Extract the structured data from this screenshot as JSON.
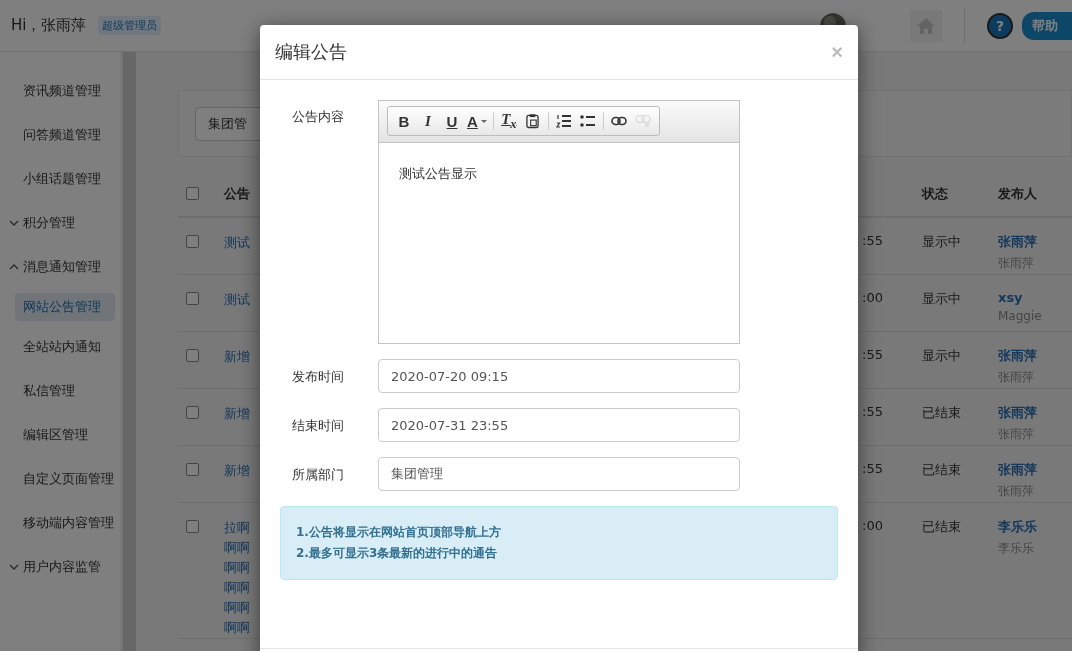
{
  "topbar": {
    "greeting": "Hi，张雨萍",
    "role_badge": "超级管理员",
    "help_icon": "?",
    "help_label": "帮助"
  },
  "sidebar": {
    "items": [
      {
        "label": "资讯频道管理",
        "kind": "link",
        "selected": false
      },
      {
        "label": "问答频道管理",
        "kind": "link",
        "selected": false
      },
      {
        "label": "小组话题管理",
        "kind": "link",
        "selected": false
      },
      {
        "label": "积分管理",
        "kind": "group",
        "expanded": false
      },
      {
        "label": "消息通知管理",
        "kind": "group",
        "expanded": true,
        "children": [
          {
            "label": "网站公告管理",
            "kind": "link",
            "selected": true
          },
          {
            "label": "全站站内通知",
            "kind": "link",
            "selected": false
          },
          {
            "label": "私信管理",
            "kind": "link",
            "selected": false
          },
          {
            "label": "编辑区管理",
            "kind": "link",
            "selected": false
          },
          {
            "label": "自定义页面管理",
            "kind": "link",
            "selected": false
          },
          {
            "label": "移动端内容管理",
            "kind": "link",
            "selected": false
          }
        ]
      },
      {
        "label": "用户内容监管",
        "kind": "group",
        "expanded": false
      }
    ]
  },
  "filter": {
    "department": "集团管"
  },
  "table": {
    "all_checked": false,
    "columns": [
      "公告",
      "状态",
      "发布人"
    ],
    "rows": [
      {
        "checked": false,
        "title": [
          "测试"
        ],
        "time": ":55",
        "status": "显示中",
        "publisher": "张雨萍",
        "publisher_sub": "张雨萍"
      },
      {
        "checked": false,
        "title": [
          "测试"
        ],
        "time": ":00",
        "status": "显示中",
        "publisher": "xsy",
        "publisher_sub": "Maggie"
      },
      {
        "checked": false,
        "title": [
          "新增"
        ],
        "time": ":55",
        "status": "显示中",
        "publisher": "张雨萍",
        "publisher_sub": "张雨萍"
      },
      {
        "checked": false,
        "title": [
          "新增"
        ],
        "time": ":55",
        "status": "已结束",
        "publisher": "张雨萍",
        "publisher_sub": "张雨萍"
      },
      {
        "checked": false,
        "title": [
          "新增"
        ],
        "time": ":55",
        "status": "已结束",
        "publisher": "张雨萍",
        "publisher_sub": "张雨萍"
      },
      {
        "checked": false,
        "title": [
          "拉啊",
          "啊啊",
          "啊啊",
          "啊啊",
          "啊啊",
          "啊啊"
        ],
        "time": ":00",
        "status": "已结束",
        "publisher": "李乐乐",
        "publisher_sub": "李乐乐"
      }
    ]
  },
  "modal": {
    "title": "编辑公告",
    "close": "×",
    "content_label": "公告内容",
    "toolbar": [
      {
        "kind": "text",
        "label": "B"
      },
      {
        "kind": "text",
        "label": "I"
      },
      {
        "kind": "text",
        "label": "U"
      },
      {
        "kind": "text",
        "label": "A"
      },
      {
        "kind": "sep"
      },
      {
        "kind": "text",
        "label": "T$_{x}$"
      },
      {
        "kind": "icon",
        "disabled": false
      },
      {
        "kind": "sep"
      },
      {
        "kind": "icon",
        "disabled": false
      },
      {
        "kind": "icon",
        "disabled": false
      },
      {
        "kind": "sep"
      },
      {
        "kind": "icon",
        "disabled": false
      },
      {
        "kind": "icon",
        "disabled": true
      }
    ],
    "content": "测试公告显示",
    "fields": [
      {
        "label": "发布时间",
        "value": "2020-07-20 09:15"
      },
      {
        "label": "结束时间",
        "value": "2020-07-31 23:55"
      },
      {
        "label": "所属部门",
        "value": "集团管理"
      }
    ],
    "notes": [
      "1.公告将显示在网站首页顶部导航上方",
      "2.最多可显示3条最新的进行中的通告"
    ]
  }
}
